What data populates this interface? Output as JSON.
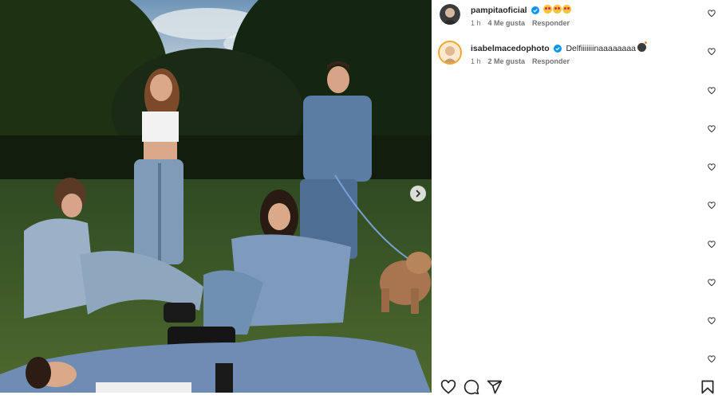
{
  "comments": [
    {
      "username": "pampitaoficial",
      "verified": true,
      "text": "",
      "emojis": [
        "heart-eyes-emoji",
        "heart-eyes-emoji",
        "heart-eyes-emoji"
      ],
      "time": "1 h",
      "likes": "4 Me gusta",
      "reply": "Responder"
    },
    {
      "username": "isabelmacedophoto",
      "verified": true,
      "text": "Delfiiiiiiinaaaaaaaa",
      "emojis": [
        "bomb-emoji"
      ],
      "time": "1 h",
      "likes": "2 Me gusta",
      "reply": "Responder"
    }
  ],
  "colors": {
    "verified": "#0095f6",
    "text": "#262626",
    "meta": "#737373"
  },
  "icons": {
    "carousel_next": "chevron-right-icon",
    "comment_like": "heart-outline-icon",
    "actions": [
      "heart-icon",
      "comment-icon",
      "share-icon",
      "bookmark-icon"
    ]
  }
}
